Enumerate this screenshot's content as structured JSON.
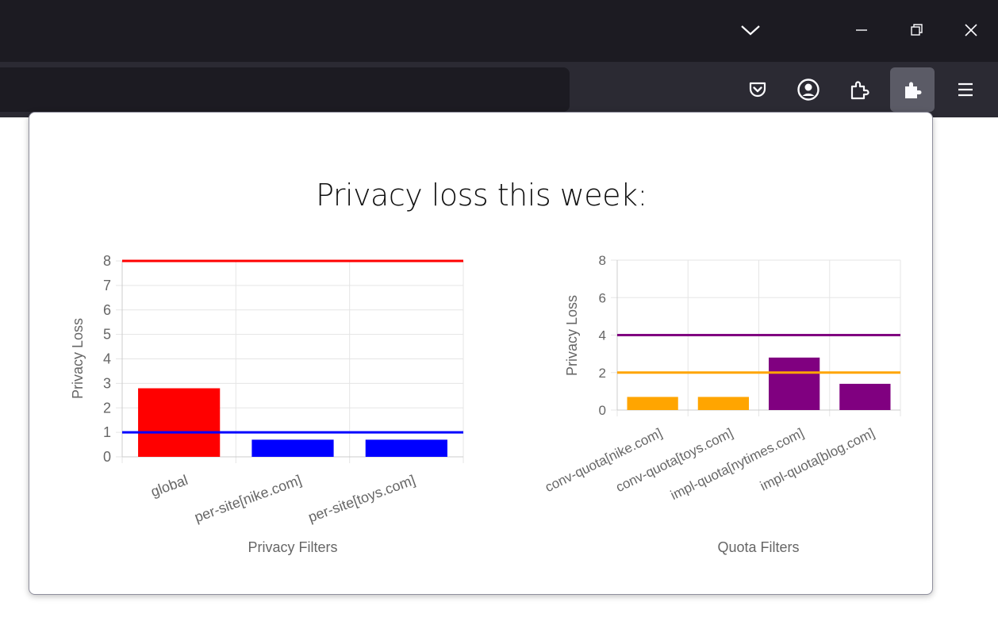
{
  "popup": {
    "title": "Privacy loss this week:"
  },
  "window_controls": {
    "list_tabs": "chevron-down-icon",
    "minimize": "minimize-icon",
    "restore": "restore-icon",
    "close": "close-icon"
  },
  "toolbar": {
    "icons": [
      "pocket-icon",
      "account-icon",
      "extension-icon",
      "puzzle-icon",
      "hamburger-menu-icon"
    ]
  },
  "colors": {
    "red": "#ff0000",
    "blue": "#0000ff",
    "orange": "#ffa500",
    "purple": "#800080",
    "grid": "#e5e5e5",
    "text": "#666666"
  },
  "chart_data": [
    {
      "type": "bar",
      "categories": [
        "global",
        "per-site[nike.com]",
        "per-site[toys.com]"
      ],
      "values": [
        2.8,
        0.7,
        0.7
      ],
      "bar_colors": [
        "#ff0000",
        "#0000ff",
        "#0000ff"
      ],
      "limits": [
        {
          "value": 8,
          "color": "#ff0000"
        },
        {
          "value": 1,
          "color": "#0000ff"
        }
      ],
      "xlabel": "Privacy Filters",
      "ylabel": "Privacy Loss",
      "ylim": [
        0,
        8
      ],
      "yticks": [
        "0",
        "1",
        "2",
        "3",
        "4",
        "5",
        "6",
        "7",
        "8"
      ],
      "grid": true
    },
    {
      "type": "bar",
      "categories": [
        "conv-quota[nike.com]",
        "conv-quota[toys.com]",
        "impl-quota[nytimes.com]",
        "impl-quota[blog.com]"
      ],
      "values": [
        0.7,
        0.7,
        2.8,
        1.4
      ],
      "bar_colors": [
        "#ffa500",
        "#ffa500",
        "#800080",
        "#800080"
      ],
      "limits": [
        {
          "value": 4,
          "color": "#800080"
        },
        {
          "value": 2,
          "color": "#ffa500"
        }
      ],
      "xlabel": "Quota Filters",
      "ylabel": "Privacy Loss",
      "ylim": [
        0,
        8
      ],
      "yticks": [
        "0",
        "2",
        "4",
        "6",
        "8"
      ],
      "grid": true
    }
  ]
}
